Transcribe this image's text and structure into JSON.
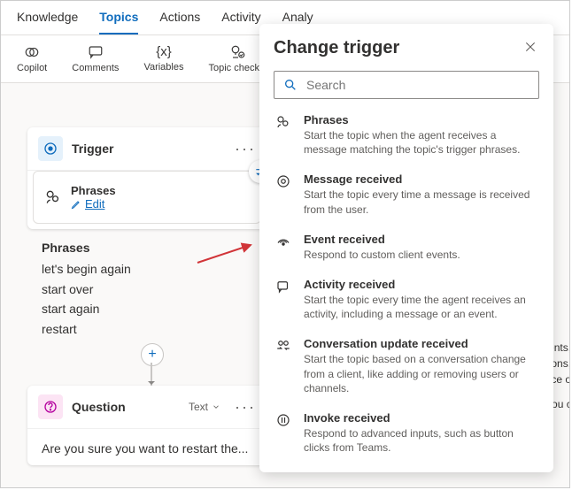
{
  "tabs": [
    "Knowledge",
    "Topics",
    "Actions",
    "Activity",
    "Analy"
  ],
  "toolbar": {
    "copilot": "Copilot",
    "comments": "Comments",
    "variables": "Variables",
    "checker": "Topic checker"
  },
  "trigger": {
    "title": "Trigger",
    "phrases_label": "Phrases",
    "edit": "Edit"
  },
  "phrases": {
    "header": "Phrases",
    "items": [
      "let's begin again",
      "start over",
      "start again",
      "restart"
    ]
  },
  "question": {
    "title": "Question",
    "type": "Text",
    "body": "Are you sure you want to restart the..."
  },
  "panel": {
    "title": "Change trigger",
    "search_placeholder": "Search",
    "options": [
      {
        "t": "Phrases",
        "d": "Start the topic when the agent receives a message matching the topic's trigger phrases."
      },
      {
        "t": "Message received",
        "d": "Start the topic every time a message is received from the user."
      },
      {
        "t": "Event received",
        "d": "Respond to custom client events."
      },
      {
        "t": "Activity received",
        "d": "Start the topic every time the agent receives an activity, including a message or an event."
      },
      {
        "t": "Conversation update received",
        "d": "Start the topic based on a conversation change from a client, like adding or removing users or channels."
      },
      {
        "t": "Invoke received",
        "d": "Respond to advanced inputs, such as button clicks from Teams."
      }
    ]
  },
  "side_text": [
    "documents, V",
    "regulations, c",
    "insurance op",
    "Note: You ca"
  ]
}
